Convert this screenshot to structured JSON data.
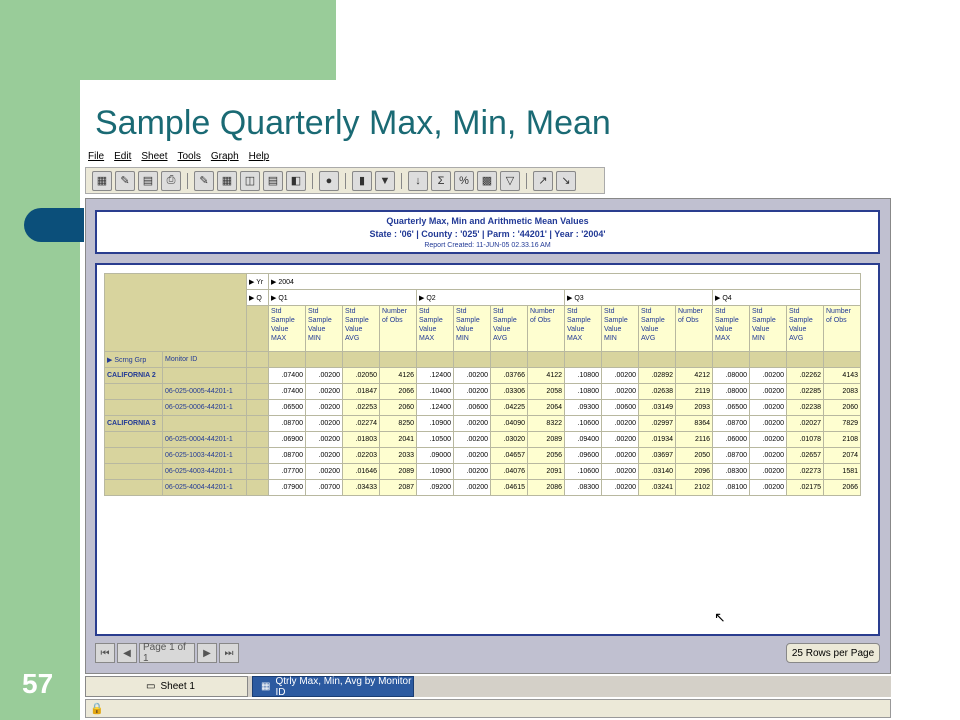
{
  "slide": {
    "title": "Sample Quarterly Max, Min, Mean",
    "number": "57"
  },
  "menu": [
    "File",
    "Edit",
    "Sheet",
    "Tools",
    "Graph",
    "Help"
  ],
  "report": {
    "title": "Quarterly Max, Min and Arithmetic Mean Values",
    "filters": "State : '06'  |  County : '025'  |  Parm : '44201'  |  Year : '2004'",
    "created": "Report Created: 11-JUN-05 02.33.16 AM"
  },
  "pivot": {
    "yr_label": "Yr",
    "yr_value": "2004",
    "q_label": "Q",
    "quarters": [
      "Q1",
      "Q2",
      "Q3",
      "Q4"
    ],
    "measures": [
      "Std Sample Value MAX",
      "Std Sample Value MIN",
      "Std Sample Value AVG",
      "Number of Obs"
    ],
    "row_dims": [
      "Scrng Grp",
      "Monitor ID"
    ],
    "rows": [
      {
        "group": "CALIFORNIA 2",
        "monitor": "",
        "vals": [
          ".07400",
          ".00200",
          ".02050",
          "4126",
          ".12400",
          ".00200",
          ".03766",
          "4122",
          ".10800",
          ".00200",
          ".02892",
          "4212",
          ".08000",
          ".00200",
          ".02262",
          "4143"
        ]
      },
      {
        "group": "",
        "monitor": "06-025-0005-44201-1",
        "vals": [
          ".07400",
          ".00200",
          ".01847",
          "2066",
          ".10400",
          ".00200",
          ".03306",
          "2058",
          ".10800",
          ".00200",
          ".02638",
          "2119",
          ".08000",
          ".00200",
          ".02285",
          "2083"
        ]
      },
      {
        "group": "",
        "monitor": "06-025-0006-44201-1",
        "vals": [
          ".06500",
          ".00200",
          ".02253",
          "2060",
          ".12400",
          ".00600",
          ".04225",
          "2064",
          ".09300",
          ".00600",
          ".03149",
          "2093",
          ".06500",
          ".00200",
          ".02238",
          "2060"
        ]
      },
      {
        "group": "CALIFORNIA 3",
        "monitor": "",
        "vals": [
          ".08700",
          ".00200",
          ".02274",
          "8250",
          ".10900",
          ".00200",
          ".04090",
          "8322",
          ".10600",
          ".00200",
          ".02997",
          "8364",
          ".08700",
          ".00200",
          ".02027",
          "7829"
        ]
      },
      {
        "group": "",
        "monitor": "06-025-0004-44201-1",
        "vals": [
          ".06900",
          ".00200",
          ".01803",
          "2041",
          ".10500",
          ".00200",
          ".03020",
          "2089",
          ".09400",
          ".00200",
          ".01934",
          "2116",
          ".06000",
          ".00200",
          ".01078",
          "2108"
        ]
      },
      {
        "group": "",
        "monitor": "06-025-1003-44201-1",
        "vals": [
          ".08700",
          ".00200",
          ".02203",
          "2033",
          ".09000",
          ".00200",
          ".04657",
          "2056",
          ".09600",
          ".00200",
          ".03697",
          "2050",
          ".08700",
          ".00200",
          ".02657",
          "2074"
        ]
      },
      {
        "group": "",
        "monitor": "06-025-4003-44201-1",
        "vals": [
          ".07700",
          ".00200",
          ".01646",
          "2089",
          ".10900",
          ".00200",
          ".04076",
          "2091",
          ".10600",
          ".00200",
          ".03140",
          "2096",
          ".08300",
          ".00200",
          ".02273",
          "1581"
        ]
      },
      {
        "group": "",
        "monitor": "06-025-4004-44201-1",
        "vals": [
          ".07900",
          ".00700",
          ".03433",
          "2087",
          ".09200",
          ".00200",
          ".04615",
          "2086",
          ".08300",
          ".00200",
          ".03241",
          "2102",
          ".08100",
          ".00200",
          ".02175",
          "2066"
        ]
      }
    ]
  },
  "pager": {
    "page_label": "Page 1 of 1",
    "rows_label": "25 Rows per Page"
  },
  "tabs": [
    "Sheet 1",
    "Qtrly Max, Min, Avg by Monitor ID"
  ],
  "colors": {
    "accent_blue": "#223a96",
    "khaki": "#d8d49e",
    "cell_yellow": "#fefed0",
    "slide_green": "#99cc99"
  }
}
